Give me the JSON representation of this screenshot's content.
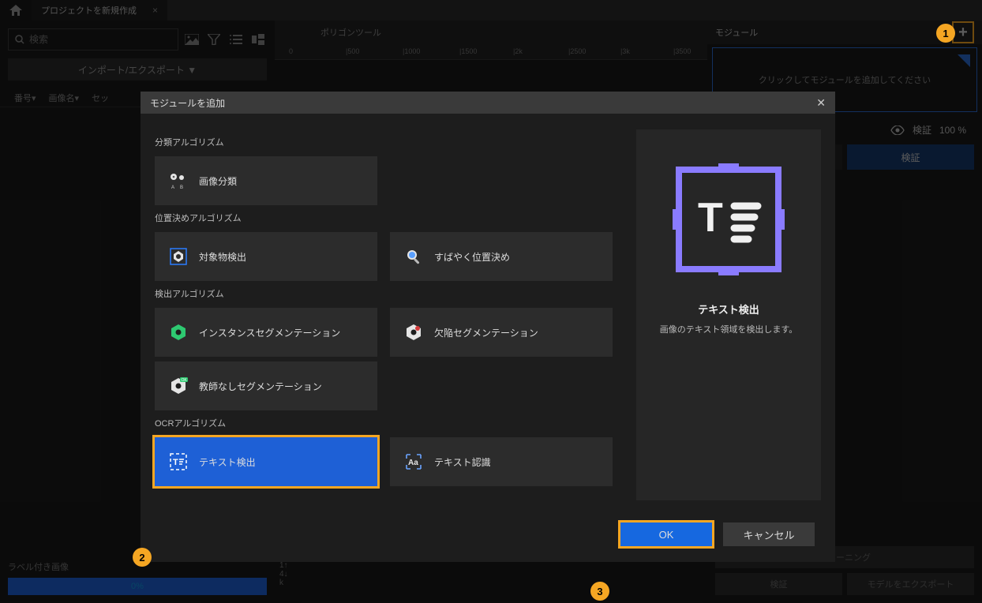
{
  "tab": {
    "title": "プロジェクトを新規作成"
  },
  "search": {
    "placeholder": "検索"
  },
  "import_btn": "インポート/エクスポート ▼",
  "columns": {
    "a": "番号▾",
    "b": "画像名▾",
    "c": "セッ"
  },
  "left_footer": {
    "label": "ラベル付き画像",
    "value": "0%"
  },
  "center_header": "ポリゴンツール",
  "ruler_marks": {
    "m0": "0",
    "m1": "|500",
    "m2": "|1000",
    "m3": "|1500",
    "m4": "|2k",
    "m5": "|2500",
    "m6": "|3k",
    "m7": "|3500"
  },
  "ruler_v": {
    "a": "1↑",
    "b": "4↓",
    "c": "k"
  },
  "right": {
    "header": "モジュール",
    "prompt": "クリックしてモジュールを追加してください",
    "verify": "検証",
    "percent": "100 %",
    "tab_train": "ーニング",
    "tab_verify": "検証",
    "btn_train": "トレーニング",
    "btn_verify": "検証",
    "btn_export": "モデルをエクスポート"
  },
  "dialog": {
    "title": "モジュールを追加",
    "sec1": "分類アルゴリズム",
    "card_classify": "画像分類",
    "sec2": "位置決めアルゴリズム",
    "card_obj": "対象物検出",
    "card_quickpos": "すばやく位置決め",
    "sec3": "検出アルゴリズム",
    "card_instance": "インスタンスセグメンテーション",
    "card_defect": "欠陥セグメンテーション",
    "card_unsup": "教師なしセグメンテーション",
    "sec4": "OCRアルゴリズム",
    "card_textdet": "テキスト検出",
    "card_textrec": "テキスト認識",
    "preview_title": "テキスト検出",
    "preview_desc": "画像のテキスト領域を検出します。",
    "ok": "OK",
    "cancel": "キャンセル"
  },
  "anno": {
    "n1": "1",
    "n2": "2",
    "n3": "3"
  }
}
